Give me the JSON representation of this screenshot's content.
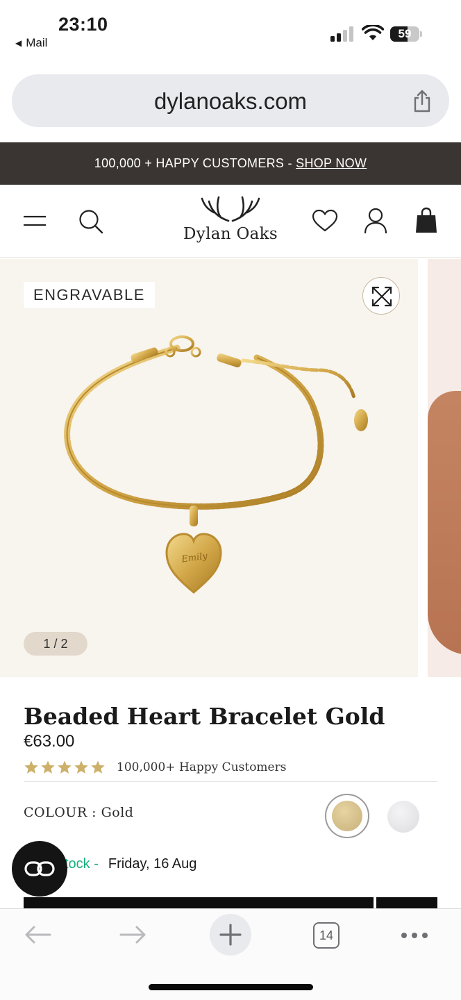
{
  "status_bar": {
    "time": "23:10",
    "back_app": "Mail",
    "battery": "59",
    "battery_level": 0.59
  },
  "browser": {
    "url": "dylanoaks.com",
    "open_tabs": "14"
  },
  "promo": {
    "text": "100,000 + HAPPY CUSTOMERS - ",
    "link": "SHOP NOW"
  },
  "header": {
    "brand": "Dylan Oaks",
    "icons": [
      "menu-icon",
      "search-icon",
      "wishlist-heart-icon",
      "account-icon",
      "bag-icon"
    ]
  },
  "gallery": {
    "badge": "ENGRAVABLE",
    "counter": "1 / 2",
    "engraving": "Emily"
  },
  "product": {
    "title": "Beaded Heart Bracelet Gold",
    "price": "€63.00",
    "rating": 5,
    "rating_text": "100,000+ Happy Customers",
    "colour_label": "COLOUR : Gold",
    "colours": [
      {
        "name": "Gold",
        "hex": "#d4bf88",
        "selected": true
      },
      {
        "name": "Silver",
        "hex": "#e6e6ea",
        "selected": false
      }
    ],
    "stock_text": "tock -",
    "delivery_date": "Friday, 16 Aug"
  },
  "colors": {
    "promo_bg": "#3a3532",
    "gallery_bg": "#f8f4ee",
    "star": "#cdb06a",
    "in_stock": "#17b07a"
  }
}
